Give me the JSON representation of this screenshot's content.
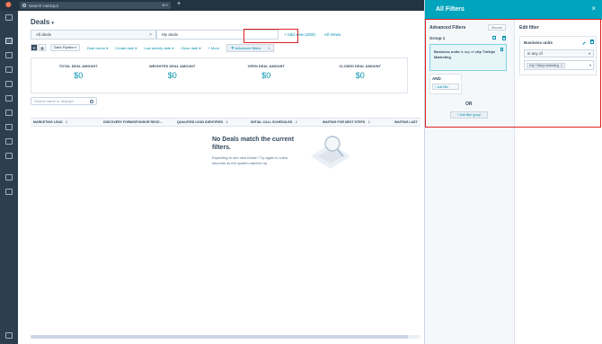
{
  "topbar": {
    "search_placeholder": "Search HubSpot",
    "shortcut": "⌘ K",
    "add_icon": "+"
  },
  "page": {
    "title": "Deals",
    "title_chevron": "▾"
  },
  "views": {
    "tabs": [
      {
        "label": "All deals"
      },
      {
        "label": "My deals"
      }
    ],
    "close_icon": "×",
    "add_view": "+ Add view (2/50)",
    "all_views": "All Views"
  },
  "filters": {
    "pipeline_pill": "Sales Pipeline ▾",
    "dropdowns": [
      "Deal owner ▾",
      "Create date ▾",
      "Last activity date ▾",
      "Close date ▾",
      "+ More"
    ],
    "advanced_label": "Advanced filters",
    "advanced_count": "1"
  },
  "summary": [
    {
      "label": "TOTAL DEAL AMOUNT",
      "value": "$0"
    },
    {
      "label": "WEIGHTED DEAL AMOUNT",
      "value": "$0"
    },
    {
      "label": "OPEN DEAL AMOUNT",
      "value": "$0"
    },
    {
      "label": "CLOSED DEAL AMOUNT",
      "value": "$0"
    }
  ],
  "table": {
    "search_placeholder": "Search name or descript",
    "columns": [
      {
        "label": "MARKETING LEAD"
      },
      {
        "label": "DISCOVERY FORM/SPONSOR RECE..."
      },
      {
        "label": "QUALIFIED LEAD IDENTIFIED"
      },
      {
        "label": "INITIAL CALL SCHEDULED"
      },
      {
        "label": "WAITING FOR NEXT STEPS"
      },
      {
        "label": "WAITING LAST"
      }
    ],
    "sort_icon": "⇕"
  },
  "empty_state": {
    "title": "No Deals match the current filters.",
    "body": "Expecting to see new Deals? Try again in a few seconds as the system catches up."
  },
  "panel": {
    "title": "All Filters",
    "close": "×",
    "advanced_title": "Advanced Filters",
    "discard": "Discard",
    "group_label": "Group 1",
    "filter_prop": "Business units",
    "filter_op": "is any of",
    "filter_value": "eXp Türkiye Marketing",
    "and_label": "AND",
    "add_filter": "+ Add filter",
    "or_label": "OR",
    "add_group": "+ Add filter group",
    "edit_title": "Edit filter",
    "edit_prop": "Business units",
    "edit_op": "is any of",
    "edit_value": "eXp Türkiye Marketing",
    "tag_close": "×",
    "chev": "▾"
  },
  "colors": {
    "accent": "#00a4bd",
    "link": "#0091ae",
    "highlight": "#e02020",
    "nav": "#2d3e50"
  }
}
